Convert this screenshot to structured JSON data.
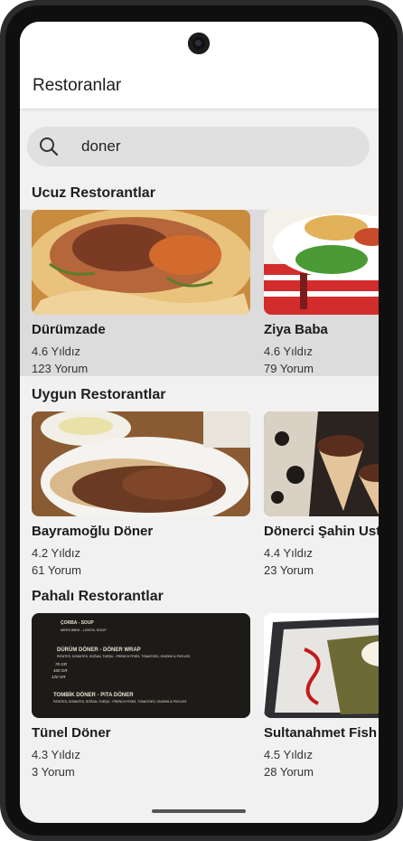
{
  "header": {
    "title": "Restoranlar"
  },
  "search": {
    "value": "doner",
    "icon": "search-icon"
  },
  "sections": [
    {
      "title": "Ucuz Restorantlar",
      "cards": [
        {
          "name": "Dürümzade",
          "rating": "4.6 Yıldız",
          "reviews": "123 Yorum",
          "image": "durum-wrap-photo"
        },
        {
          "name": "Ziya Baba",
          "rating": "4.6 Yıldız",
          "reviews": "79 Yorum",
          "image": "doner-plate-photo"
        }
      ]
    },
    {
      "title": "Uygun Restorantlar",
      "cards": [
        {
          "name": "Bayramoğlu Döner",
          "rating": "4.2 Yıldız",
          "reviews": "61 Yorum",
          "image": "iskender-plate-photo"
        },
        {
          "name": "Dönerci Şahin Usta",
          "rating": "4.4 Yıldız",
          "reviews": "23 Yorum",
          "image": "doner-cones-photo"
        }
      ]
    },
    {
      "title": "Pahalı Restorantlar",
      "cards": [
        {
          "name": "Tünel Döner",
          "rating": "4.3 Yıldız",
          "reviews": "3 Yorum",
          "image": "menu-board-photo"
        },
        {
          "name": "Sultanahmet Fish House",
          "rating": "4.5 Yıldız",
          "reviews": "28 Yorum",
          "image": "dessert-plate-photo"
        }
      ]
    }
  ],
  "menu_board": {
    "lines": [
      "ÇORBA - SOUP",
      "MERCİMEK - LENTIL SOUP",
      "DÜRÜM DÖNER - DÖNER WRAP",
      "PATATES, DOMATES, SOĞAN, TURŞU - FRENCH FRIES, TOMATOES, ONIONS & PICKLES",
      "70 GR",
      "100 GR",
      "120 GR",
      "TOMBİK DÖNER - PITA DÖNER",
      "PATATES, DOMATES, SOĞAN, TURŞU - FRENCH FRIES, TOMATOES, ONIONS & PICKLES"
    ]
  }
}
